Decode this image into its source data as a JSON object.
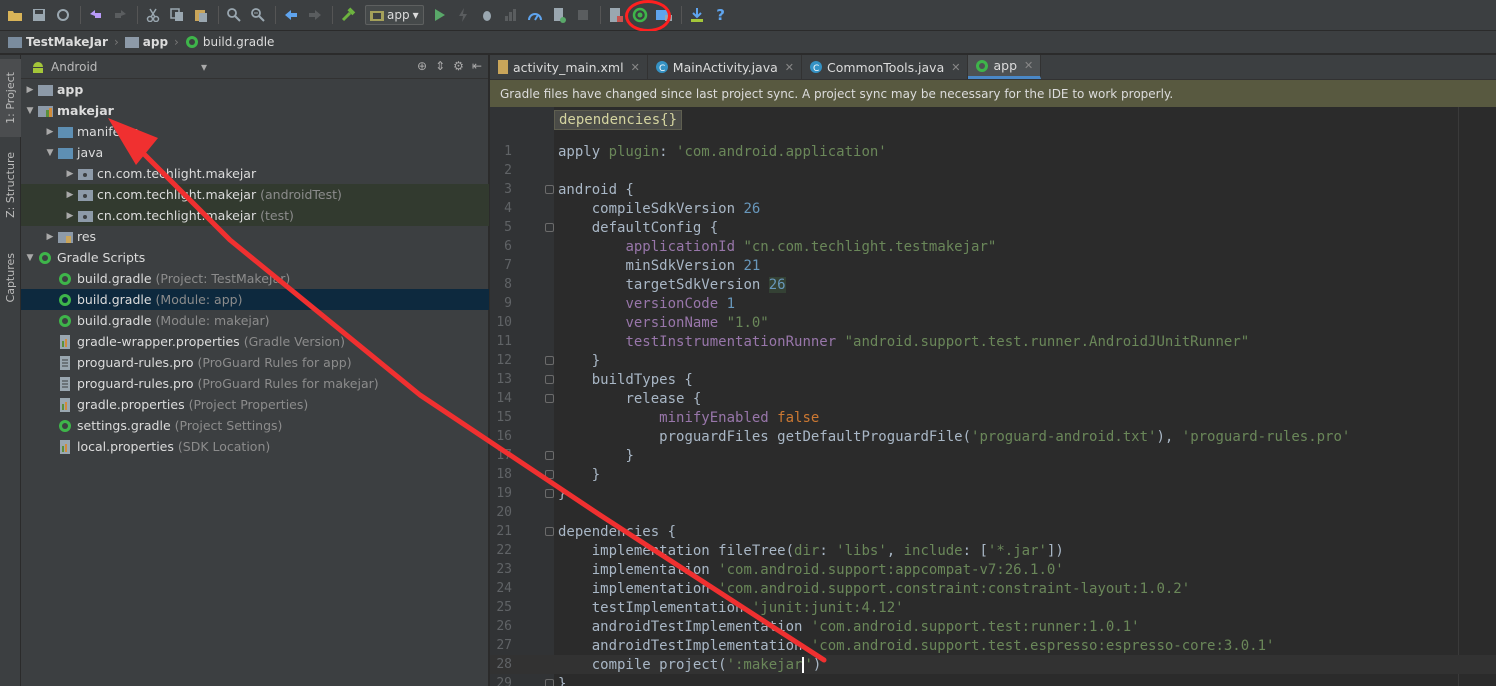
{
  "toolbar": {
    "run_config": "app",
    "colors": {
      "accent_red": "#ff2020",
      "sync_icon": "#3eb54a"
    },
    "icons": [
      "open-folder-icon",
      "save-icon",
      "sync-icon",
      "undo-icon",
      "redo-icon",
      "cut-icon",
      "copy-icon",
      "paste-icon",
      "find-icon",
      "replace-icon",
      "back-icon",
      "forward-icon",
      "make-project-icon",
      "run-icon",
      "apply-changes-icon",
      "debug-icon",
      "profile-icon",
      "attach-debugger-icon",
      "stop-icon",
      "avd-manager-icon",
      "sync-gradle-icon",
      "project-structure-icon",
      "sdk-manager-icon",
      "help-icon"
    ]
  },
  "breadcrumb": {
    "items": [
      "TestMakeJar",
      "app",
      "build.gradle"
    ]
  },
  "side_strip": {
    "tabs": [
      "1: Project",
      "Z: Structure",
      "Captures"
    ]
  },
  "project_panel": {
    "view_mode": "Android",
    "tree": [
      {
        "label": "app",
        "sub": "",
        "bold": true
      },
      {
        "label": "makejar",
        "sub": "",
        "bold": true
      },
      {
        "label": "manifests",
        "sub": ""
      },
      {
        "label": "java",
        "sub": ""
      },
      {
        "label": "cn.com.techlight.makejar",
        "sub": ""
      },
      {
        "label": "cn.com.techlight.makejar",
        "sub": "(androidTest)"
      },
      {
        "label": "cn.com.techlight.makejar",
        "sub": "(test)"
      },
      {
        "label": "res",
        "sub": ""
      },
      {
        "label": "Gradle Scripts",
        "sub": ""
      },
      {
        "label": "build.gradle",
        "sub": "(Project: TestMakeJar)"
      },
      {
        "label": "build.gradle",
        "sub": "(Module: app)"
      },
      {
        "label": "build.gradle",
        "sub": "(Module: makejar)"
      },
      {
        "label": "gradle-wrapper.properties",
        "sub": "(Gradle Version)"
      },
      {
        "label": "proguard-rules.pro",
        "sub": "(ProGuard Rules for app)"
      },
      {
        "label": "proguard-rules.pro",
        "sub": "(ProGuard Rules for makejar)"
      },
      {
        "label": "gradle.properties",
        "sub": "(Project Properties)"
      },
      {
        "label": "settings.gradle",
        "sub": "(Project Settings)"
      },
      {
        "label": "local.properties",
        "sub": "(SDK Location)"
      }
    ]
  },
  "editor": {
    "tabs": [
      "activity_main.xml",
      "MainActivity.java",
      "CommonTools.java",
      "app"
    ],
    "active_tab": "app",
    "banner": "Gradle files have changed since last project sync. A project sync may be necessary for the IDE to work properly.",
    "scope_label": "dependencies{}",
    "line_numbers": [
      "1",
      "2",
      "3",
      "4",
      "5",
      "6",
      "7",
      "8",
      "9",
      "10",
      "11",
      "12",
      "13",
      "14",
      "15",
      "16",
      "17",
      "18",
      "19",
      "20",
      "21",
      "22",
      "23",
      "24",
      "25",
      "26",
      "27",
      "28",
      "29"
    ],
    "code": {
      "l1a": "apply ",
      "l1b": "plugin",
      "l1c": ": ",
      "l1d": "'com.android.application'",
      "l3": "android {",
      "l4a": "compileSdkVersion ",
      "l4b": "26",
      "l5": "defaultConfig {",
      "l6a": "applicationId ",
      "l6b": "\"cn.com.techlight.testmakejar\"",
      "l7a": "minSdkVersion ",
      "l7b": "21",
      "l8a": "targetSdkVersion ",
      "l8b": "26",
      "l9a": "versionCode ",
      "l9b": "1",
      "l10a": "versionName ",
      "l10b": "\"1.0\"",
      "l11a": "testInstrumentationRunner ",
      "l11b": "\"android.support.test.runner.AndroidJUnitRunner\"",
      "close_brace": "}",
      "l13": "buildTypes {",
      "l14": "release {",
      "l15a": "minifyEnabled ",
      "l15b": "false",
      "l16a": "proguardFiles getDefaultProguardFile(",
      "l16b": "'proguard-android.txt'",
      "l16c": "), ",
      "l16d": "'proguard-rules.pro'",
      "l21": "dependencies {",
      "l22a": "implementation fileTree(",
      "l22b": "dir",
      "l22c": ": ",
      "l22d": "'libs'",
      "l22e": ", ",
      "l22f": "include",
      "l22g": ": [",
      "l22h": "'*.jar'",
      "l22i": "])",
      "l23a": "implementation ",
      "l23b": "'com.android.support:appcompat-v7:26.1.0'",
      "l24a": "implementation ",
      "l24b": "'com.android.support.constraint:constraint-layout:1.0.2'",
      "l25a": "testImplementation ",
      "l25b": "'junit:junit:4.12'",
      "l26a": "androidTestImplementation ",
      "l26b": "'com.android.support.test:runner:1.0.1'",
      "l27a": "androidTestImplementation ",
      "l27b": "'com.android.support.test.espresso:espresso-core:3.0.1'",
      "l28a": "compile project(",
      "l28b": "':makejar",
      "l28c": "'",
      "l28d": ")"
    }
  }
}
